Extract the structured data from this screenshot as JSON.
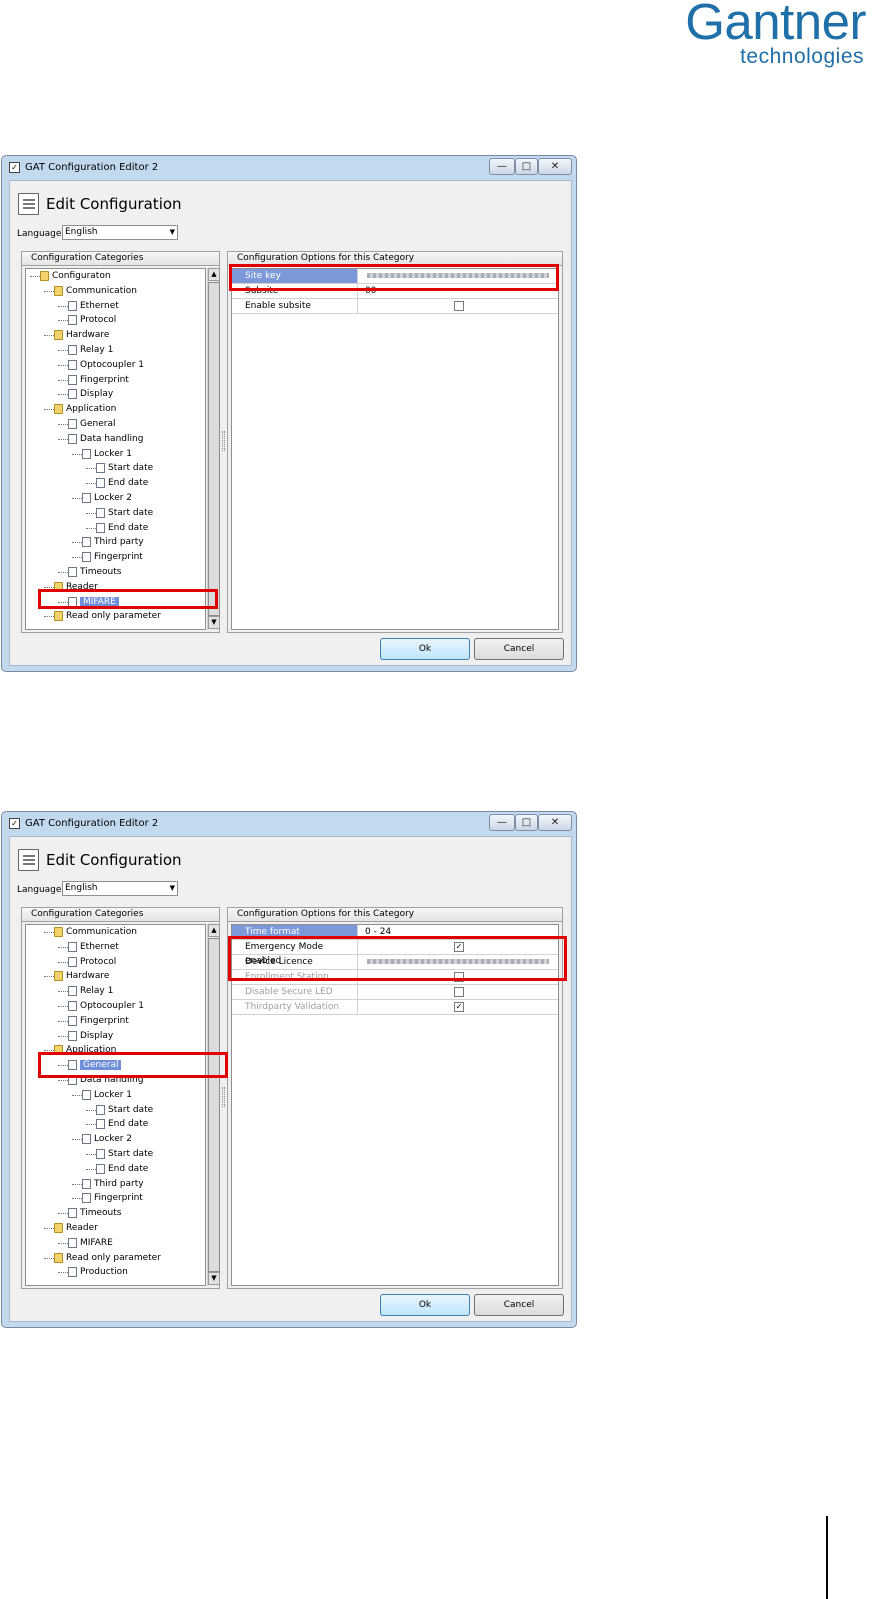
{
  "brand": {
    "name": "Gantner",
    "tagline": "technologies"
  },
  "windows": [
    {
      "title": "GAT Configuration Editor 2",
      "caption_buttons": {
        "minimize": "—",
        "maximize": "□",
        "close": "✕"
      },
      "header_title": "Edit Configuration",
      "language_label": "Language:",
      "language_value": "English",
      "categories_label": "Configuration Categories",
      "options_label": "Configuration Options for this Category",
      "tree": [
        {
          "label": "Configuraton",
          "type": "folder",
          "level": 0
        },
        {
          "label": "Communication",
          "type": "folder",
          "level": 1
        },
        {
          "label": "Ethernet",
          "type": "page",
          "level": 2
        },
        {
          "label": "Protocol",
          "type": "page",
          "level": 2
        },
        {
          "label": "Hardware",
          "type": "folder",
          "level": 1
        },
        {
          "label": "Relay 1",
          "type": "page",
          "level": 2
        },
        {
          "label": "Optocoupler 1",
          "type": "page",
          "level": 2
        },
        {
          "label": "Fingerprint",
          "type": "page",
          "level": 2
        },
        {
          "label": "Display",
          "type": "page",
          "level": 2
        },
        {
          "label": "Application",
          "type": "folder",
          "level": 1
        },
        {
          "label": "General",
          "type": "page",
          "level": 2
        },
        {
          "label": "Data handling",
          "type": "page",
          "level": 2
        },
        {
          "label": "Locker 1",
          "type": "page",
          "level": 3
        },
        {
          "label": "Start date",
          "type": "page",
          "level": 4
        },
        {
          "label": "End date",
          "type": "page",
          "level": 4
        },
        {
          "label": "Locker 2",
          "type": "page",
          "level": 3
        },
        {
          "label": "Start date",
          "type": "page",
          "level": 4
        },
        {
          "label": "End date",
          "type": "page",
          "level": 4
        },
        {
          "label": "Third party",
          "type": "page",
          "level": 3
        },
        {
          "label": "Fingerprint",
          "type": "page",
          "level": 3
        },
        {
          "label": "Timeouts",
          "type": "page",
          "level": 2
        },
        {
          "label": "Reader",
          "type": "folder",
          "level": 1
        },
        {
          "label": "MIFARE",
          "type": "page",
          "level": 2,
          "selected": true
        },
        {
          "label": "Read only parameter",
          "type": "folder",
          "level": 1
        }
      ],
      "properties": [
        {
          "name": "Site key",
          "value": "",
          "blurred": true,
          "selected": true
        },
        {
          "name": "Subsite",
          "value": "00"
        },
        {
          "name": "Enable subsite",
          "checkbox": true,
          "checked": false
        }
      ],
      "ok_label": "Ok",
      "cancel_label": "Cancel"
    },
    {
      "title": "GAT Configuration Editor 2",
      "caption_buttons": {
        "minimize": "—",
        "maximize": "□",
        "close": "✕"
      },
      "header_title": "Edit Configuration",
      "language_label": "Language:",
      "language_value": "English",
      "categories_label": "Configuration Categories",
      "options_label": "Configuration Options for this Category",
      "tree": [
        {
          "label": "Communication",
          "type": "folder",
          "level": 1
        },
        {
          "label": "Ethernet",
          "type": "page",
          "level": 2
        },
        {
          "label": "Protocol",
          "type": "page",
          "level": 2
        },
        {
          "label": "Hardware",
          "type": "folder",
          "level": 1
        },
        {
          "label": "Relay 1",
          "type": "page",
          "level": 2
        },
        {
          "label": "Optocoupler 1",
          "type": "page",
          "level": 2
        },
        {
          "label": "Fingerprint",
          "type": "page",
          "level": 2
        },
        {
          "label": "Display",
          "type": "page",
          "level": 2
        },
        {
          "label": "Application",
          "type": "folder",
          "level": 1
        },
        {
          "label": "General",
          "type": "page",
          "level": 2,
          "selected": true
        },
        {
          "label": "Data handling",
          "type": "page",
          "level": 2
        },
        {
          "label": "Locker 1",
          "type": "page",
          "level": 3
        },
        {
          "label": "Start date",
          "type": "page",
          "level": 4
        },
        {
          "label": "End date",
          "type": "page",
          "level": 4
        },
        {
          "label": "Locker 2",
          "type": "page",
          "level": 3
        },
        {
          "label": "Start date",
          "type": "page",
          "level": 4
        },
        {
          "label": "End date",
          "type": "page",
          "level": 4
        },
        {
          "label": "Third party",
          "type": "page",
          "level": 3
        },
        {
          "label": "Fingerprint",
          "type": "page",
          "level": 3
        },
        {
          "label": "Timeouts",
          "type": "page",
          "level": 2
        },
        {
          "label": "Reader",
          "type": "folder",
          "level": 1
        },
        {
          "label": "MIFARE",
          "type": "page",
          "level": 2
        },
        {
          "label": "Read only parameter",
          "type": "folder",
          "level": 1
        },
        {
          "label": "Production",
          "type": "page",
          "level": 2
        }
      ],
      "properties": [
        {
          "name": "Time format",
          "value": "0 - 24",
          "selected": true
        },
        {
          "name": "Emergency Mode enabled",
          "checkbox": true,
          "checked": true
        },
        {
          "name": "Device Licence",
          "value": "",
          "blurred": true
        },
        {
          "name": "Enrollment Station",
          "checkbox": true,
          "checked": false,
          "disabled": true
        },
        {
          "name": "Disable Secure LED",
          "checkbox": true,
          "checked": false,
          "disabled": true
        },
        {
          "name": "Thirdparty Validation",
          "checkbox": true,
          "checked": true,
          "disabled": true
        }
      ],
      "ok_label": "Ok",
      "cancel_label": "Cancel"
    }
  ],
  "colors": {
    "brand": "#1f6fa8",
    "highlight": "#e00000",
    "selection": "#6f8fdb"
  }
}
